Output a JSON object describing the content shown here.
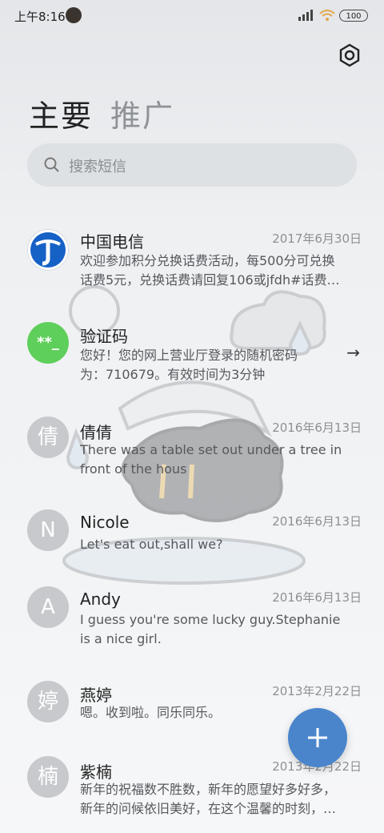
{
  "status": {
    "time": "上午8:16",
    "battery": "100"
  },
  "tabs": [
    {
      "label": "主要"
    },
    {
      "label": "推广"
    }
  ],
  "search": {
    "placeholder": "搜索短信"
  },
  "conversations": [
    {
      "avatar_text": "",
      "avatar_icon": "china-telecom-logo",
      "name": "中国电信",
      "date": "2017年6月30日",
      "lines": [
        "欢迎参加积分兑换话费活动，每500分可兑换",
        "话费5元，兑换话费请回复106或jfdh#话费…"
      ]
    },
    {
      "avatar_text": "**_",
      "name": "验证码",
      "date": "",
      "lines": [
        "您好！您的网上营业厅登录的随机密码",
        "为：710679。有效时间为3分钟"
      ],
      "avatar_color": "#5fcf5b"
    },
    {
      "avatar_text": "倩",
      "name": "倩倩",
      "date": "2016年6月13日",
      "lines": [
        "There was a table set out under a tree in",
        "front of the hous"
      ]
    },
    {
      "avatar_text": "N",
      "name": "Nicole",
      "date": "2016年6月13日",
      "lines": [
        "Let's eat out,shall we?"
      ]
    },
    {
      "avatar_text": "A",
      "name": "Andy",
      "date": "2016年6月13日",
      "lines": [
        "I guess you're some lucky guy.Stephanie",
        "is a nice girl."
      ]
    },
    {
      "avatar_text": "婷",
      "name": "燕婷",
      "date": "2013年2月22日",
      "lines": [
        "嗯。收到啦。同乐同乐。"
      ]
    },
    {
      "avatar_text": "楠",
      "name": "紫楠",
      "date": "2013年2月22日",
      "lines": [
        "新年的祝福数不胜数，新年的愿望好多好多，",
        "新年的问候依旧美好，在这个温馨的时刻，…"
      ]
    }
  ],
  "icons": {
    "settings": "gear-icon",
    "search": "search-icon",
    "fab": "plus-icon",
    "open": "arrow-right-icon"
  },
  "colors": {
    "accent": "#4a85cc",
    "verify_avatar": "#5fcf5b"
  }
}
